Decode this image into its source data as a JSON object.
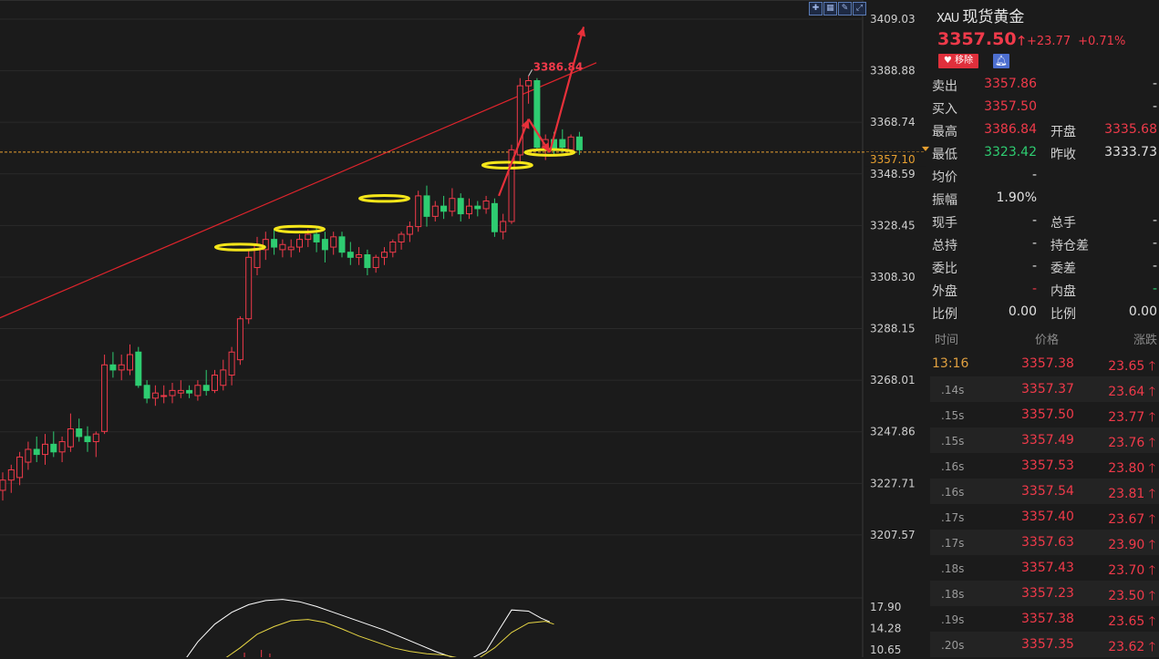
{
  "header": {
    "symbol": "XAU",
    "name": "现货黄金",
    "price": "3357.50",
    "change": "+23.77",
    "change_pct": "+0.71%",
    "remove_label": "移除",
    "up_color": "#f03a4a",
    "down_color": "#2ecc71"
  },
  "quote_rows": [
    {
      "l1": "卖出",
      "v1": "3357.86",
      "c1": "red",
      "l2": "",
      "v2": "-",
      "c2": "white"
    },
    {
      "l1": "买入",
      "v1": "3357.50",
      "c1": "red",
      "l2": "",
      "v2": "-",
      "c2": "white"
    },
    {
      "l1": "最高",
      "v1": "3386.84",
      "c1": "red",
      "l2": "开盘",
      "v2": "3335.68",
      "c2": "red"
    },
    {
      "l1": "最低",
      "v1": "3323.42",
      "c1": "green",
      "l2": "昨收",
      "v2": "3333.73",
      "c2": "white"
    },
    {
      "l1": "均价",
      "v1": "-",
      "c1": "white",
      "l2": "",
      "v2": "",
      "c2": "white"
    },
    {
      "l1": "振幅",
      "v1": "1.90%",
      "c1": "white",
      "l2": "",
      "v2": "",
      "c2": "white"
    },
    {
      "l1": "现手",
      "v1": "-",
      "c1": "white",
      "l2": "总手",
      "v2": "-",
      "c2": "white"
    },
    {
      "l1": "总持",
      "v1": "-",
      "c1": "white",
      "l2": "持仓差",
      "v2": "-",
      "c2": "white"
    },
    {
      "l1": "委比",
      "v1": "-",
      "c1": "white",
      "l2": "委差",
      "v2": "-",
      "c2": "white"
    },
    {
      "l1": "外盘",
      "v1": "-",
      "c1": "red",
      "l2": "内盘",
      "v2": "-",
      "c2": "green"
    },
    {
      "l1": "比例",
      "v1": "0.00",
      "c1": "white",
      "l2": "比例",
      "v2": "0.00",
      "c2": "white"
    }
  ],
  "ticks_header": {
    "time": "时间",
    "price": "价格",
    "change": "涨跌"
  },
  "ticks": [
    {
      "time": "13:16",
      "price": "3357.38",
      "change": "23.65"
    },
    {
      "time": ".14s",
      "price": "3357.37",
      "change": "23.64"
    },
    {
      "time": ".15s",
      "price": "3357.50",
      "change": "23.77"
    },
    {
      "time": ".15s",
      "price": "3357.49",
      "change": "23.76"
    },
    {
      "time": ".16s",
      "price": "3357.53",
      "change": "23.80"
    },
    {
      "time": ".16s",
      "price": "3357.54",
      "change": "23.81"
    },
    {
      "time": ".17s",
      "price": "3357.40",
      "change": "23.67"
    },
    {
      "time": ".17s",
      "price": "3357.63",
      "change": "23.90"
    },
    {
      "time": ".18s",
      "price": "3357.43",
      "change": "23.70"
    },
    {
      "time": ".18s",
      "price": "3357.23",
      "change": "23.50"
    },
    {
      "time": ".19s",
      "price": "3357.38",
      "change": "23.65"
    },
    {
      "time": ".20s",
      "price": "3357.35",
      "change": "23.62"
    }
  ],
  "chart_data": {
    "type": "candlestick",
    "y_ticks": [
      "3409.03",
      "3388.88",
      "3368.74",
      "3348.59",
      "3328.45",
      "3308.30",
      "3288.15",
      "3268.01",
      "3247.86",
      "3227.71",
      "3207.57"
    ],
    "ylim": [
      3200,
      3412
    ],
    "current_price_label": "3357.10",
    "current_price": 3357.1,
    "high_label": "3386.84",
    "high_value": 3386.84,
    "trendline": [
      {
        "i": -2,
        "price": 3290
      },
      {
        "i": 70,
        "price": 3392
      }
    ],
    "candles": [
      {
        "o": 3225,
        "h": 3232,
        "l": 3221,
        "c": 3229
      },
      {
        "o": 3229,
        "h": 3235,
        "l": 3224,
        "c": 3233
      },
      {
        "o": 3230,
        "h": 3240,
        "l": 3227,
        "c": 3238
      },
      {
        "o": 3236,
        "h": 3244,
        "l": 3233,
        "c": 3241
      },
      {
        "o": 3241,
        "h": 3246,
        "l": 3236,
        "c": 3239
      },
      {
        "o": 3239,
        "h": 3247,
        "l": 3235,
        "c": 3243
      },
      {
        "o": 3243,
        "h": 3248,
        "l": 3238,
        "c": 3240
      },
      {
        "o": 3240,
        "h": 3246,
        "l": 3236,
        "c": 3244
      },
      {
        "o": 3242,
        "h": 3255,
        "l": 3240,
        "c": 3249
      },
      {
        "o": 3249,
        "h": 3253,
        "l": 3244,
        "c": 3246
      },
      {
        "o": 3246,
        "h": 3250,
        "l": 3240,
        "c": 3244
      },
      {
        "o": 3244,
        "h": 3248,
        "l": 3238,
        "c": 3247
      },
      {
        "o": 3248,
        "h": 3278,
        "l": 3247,
        "c": 3274
      },
      {
        "o": 3274,
        "h": 3279,
        "l": 3269,
        "c": 3272
      },
      {
        "o": 3272,
        "h": 3278,
        "l": 3268,
        "c": 3274
      },
      {
        "o": 3272,
        "h": 3282,
        "l": 3270,
        "c": 3278
      },
      {
        "o": 3279,
        "h": 3281,
        "l": 3265,
        "c": 3266
      },
      {
        "o": 3266,
        "h": 3268,
        "l": 3259,
        "c": 3261
      },
      {
        "o": 3261,
        "h": 3266,
        "l": 3258,
        "c": 3263
      },
      {
        "o": 3262,
        "h": 3266,
        "l": 3259,
        "c": 3262
      },
      {
        "o": 3262,
        "h": 3267,
        "l": 3259,
        "c": 3264
      },
      {
        "o": 3263,
        "h": 3268,
        "l": 3261,
        "c": 3264
      },
      {
        "o": 3264,
        "h": 3266,
        "l": 3261,
        "c": 3263
      },
      {
        "o": 3262,
        "h": 3268,
        "l": 3260,
        "c": 3266
      },
      {
        "o": 3266,
        "h": 3272,
        "l": 3262,
        "c": 3264
      },
      {
        "o": 3264,
        "h": 3272,
        "l": 3263,
        "c": 3270
      },
      {
        "o": 3266,
        "h": 3276,
        "l": 3264,
        "c": 3272
      },
      {
        "o": 3270,
        "h": 3281,
        "l": 3266,
        "c": 3279
      },
      {
        "o": 3276,
        "h": 3293,
        "l": 3274,
        "c": 3292
      },
      {
        "o": 3292,
        "h": 3319,
        "l": 3290,
        "c": 3316
      },
      {
        "o": 3312,
        "h": 3324,
        "l": 3309,
        "c": 3321
      },
      {
        "o": 3319,
        "h": 3326,
        "l": 3315,
        "c": 3323
      },
      {
        "o": 3323,
        "h": 3327,
        "l": 3317,
        "c": 3320
      },
      {
        "o": 3319,
        "h": 3323,
        "l": 3316,
        "c": 3321
      },
      {
        "o": 3319,
        "h": 3323,
        "l": 3316,
        "c": 3320
      },
      {
        "o": 3320,
        "h": 3325,
        "l": 3318,
        "c": 3323
      },
      {
        "o": 3323,
        "h": 3327,
        "l": 3320,
        "c": 3325
      },
      {
        "o": 3325,
        "h": 3328,
        "l": 3318,
        "c": 3322
      },
      {
        "o": 3323,
        "h": 3326,
        "l": 3314,
        "c": 3319
      },
      {
        "o": 3320,
        "h": 3326,
        "l": 3317,
        "c": 3324
      },
      {
        "o": 3324,
        "h": 3326,
        "l": 3316,
        "c": 3318
      },
      {
        "o": 3318,
        "h": 3322,
        "l": 3313,
        "c": 3316
      },
      {
        "o": 3316,
        "h": 3320,
        "l": 3313,
        "c": 3317
      },
      {
        "o": 3317,
        "h": 3319,
        "l": 3309,
        "c": 3312
      },
      {
        "o": 3312,
        "h": 3317,
        "l": 3310,
        "c": 3316
      },
      {
        "o": 3316,
        "h": 3320,
        "l": 3313,
        "c": 3318
      },
      {
        "o": 3318,
        "h": 3323,
        "l": 3316,
        "c": 3322
      },
      {
        "o": 3322,
        "h": 3326,
        "l": 3319,
        "c": 3325
      },
      {
        "o": 3325,
        "h": 3330,
        "l": 3322,
        "c": 3328
      },
      {
        "o": 3328,
        "h": 3342,
        "l": 3326,
        "c": 3340
      },
      {
        "o": 3340,
        "h": 3344,
        "l": 3328,
        "c": 3332
      },
      {
        "o": 3332,
        "h": 3338,
        "l": 3330,
        "c": 3336
      },
      {
        "o": 3336,
        "h": 3340,
        "l": 3331,
        "c": 3334
      },
      {
        "o": 3334,
        "h": 3343,
        "l": 3332,
        "c": 3339
      },
      {
        "o": 3339,
        "h": 3341,
        "l": 3330,
        "c": 3333
      },
      {
        "o": 3333,
        "h": 3339,
        "l": 3331,
        "c": 3336
      },
      {
        "o": 3336,
        "h": 3338,
        "l": 3332,
        "c": 3335
      },
      {
        "o": 3335,
        "h": 3340,
        "l": 3333,
        "c": 3338
      },
      {
        "o": 3337,
        "h": 3339,
        "l": 3324,
        "c": 3326
      },
      {
        "o": 3326,
        "h": 3333,
        "l": 3323,
        "c": 3330
      },
      {
        "o": 3330,
        "h": 3360,
        "l": 3329,
        "c": 3358
      },
      {
        "o": 3356,
        "h": 3386,
        "l": 3353,
        "c": 3383
      },
      {
        "o": 3383,
        "h": 3387,
        "l": 3376,
        "c": 3385
      },
      {
        "o": 3385,
        "h": 3386,
        "l": 3358,
        "c": 3359
      },
      {
        "o": 3359,
        "h": 3364,
        "l": 3354,
        "c": 3362
      },
      {
        "o": 3362,
        "h": 3365,
        "l": 3356,
        "c": 3358
      },
      {
        "o": 3362,
        "h": 3366,
        "l": 3357,
        "c": 3359
      },
      {
        "o": 3358,
        "h": 3364,
        "l": 3356,
        "c": 3363
      },
      {
        "o": 3363,
        "h": 3365,
        "l": 3356,
        "c": 3358
      }
    ],
    "highlight_ellipses": [
      {
        "i": 28,
        "price": 3320
      },
      {
        "i": 35,
        "price": 3327
      },
      {
        "i": 45,
        "price": 3339
      },
      {
        "i": 59.5,
        "price": 3352
      },
      {
        "i": 64.5,
        "price": 3357
      }
    ],
    "arrows": [
      {
        "from": {
          "i": 58.5,
          "price": 3340
        },
        "to": {
          "i": 62,
          "price": 3370
        }
      },
      {
        "from": {
          "i": 62,
          "price": 3370
        },
        "to": {
          "i": 64.5,
          "price": 3357
        }
      },
      {
        "from": {
          "i": 64.5,
          "price": 3357
        },
        "to": {
          "i": 68.5,
          "price": 3406
        }
      }
    ],
    "indicator": {
      "y_ticks": [
        "17.90",
        "14.28",
        "10.65"
      ],
      "ylim": [
        8,
        20
      ],
      "line1": [
        [
          21,
          8
        ],
        [
          23,
          12
        ],
        [
          25,
          15
        ],
        [
          27,
          17
        ],
        [
          29,
          18.3
        ],
        [
          31,
          19
        ],
        [
          33,
          19.2
        ],
        [
          35,
          18.8
        ],
        [
          37,
          18
        ],
        [
          39,
          17
        ],
        [
          41,
          16
        ],
        [
          43,
          15
        ],
        [
          45,
          14
        ],
        [
          47,
          12.8
        ],
        [
          49,
          11.6
        ],
        [
          51,
          10.4
        ],
        [
          53,
          9.4
        ],
        [
          55,
          9
        ],
        [
          57,
          10.5
        ],
        [
          58.5,
          14
        ],
        [
          60,
          17.4
        ],
        [
          62,
          17.2
        ],
        [
          63.5,
          16
        ],
        [
          64.5,
          15.4
        ]
      ],
      "line2": [
        [
          26,
          9
        ],
        [
          28,
          11
        ],
        [
          30,
          13.3
        ],
        [
          32,
          14.6
        ],
        [
          34,
          15.6
        ],
        [
          36,
          15.8
        ],
        [
          38,
          15.3
        ],
        [
          40,
          14.2
        ],
        [
          42,
          13
        ],
        [
          44,
          12
        ],
        [
          46,
          11
        ],
        [
          48,
          10.4
        ],
        [
          50,
          10
        ],
        [
          52,
          9.8
        ],
        [
          54,
          9.2
        ],
        [
          56,
          9.1
        ],
        [
          58,
          11
        ],
        [
          60,
          13.6
        ],
        [
          62,
          15.2
        ],
        [
          64,
          15.5
        ],
        [
          65,
          15
        ]
      ],
      "line1_color": "#ffffff",
      "line2_color": "#e6d544"
    }
  }
}
